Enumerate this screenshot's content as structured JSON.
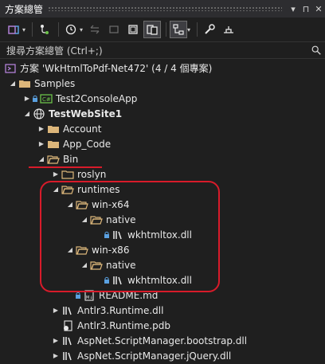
{
  "window": {
    "title": "方案總管",
    "buttons": [
      "▾",
      "⊓",
      "✕"
    ]
  },
  "toolbar": {
    "icons": [
      "switch-views-icon",
      "git-icon",
      "history-icon",
      "back-icon",
      "forward-icon",
      "collapse-all-icon",
      "show-all-files-icon",
      "preview-icon",
      "properties-icon",
      "pin-icon"
    ]
  },
  "search": {
    "placeholder": "搜尋方案總管 (Ctrl+;)"
  },
  "tree": {
    "solution": "方案 'WkHtmlToPdf-Net472' (4 / 4 個專案)",
    "samples": "Samples",
    "test2": "Test2ConsoleApp",
    "website": "TestWebSite1",
    "account": "Account",
    "appcode": "App_Code",
    "bin": "Bin",
    "roslyn": "roslyn",
    "runtimes": "runtimes",
    "winx64": "win-x64",
    "native1": "native",
    "dll1": "wkhtmltox.dll",
    "winx86": "win-x86",
    "native2": "native",
    "dll2": "wkhtmltox.dll",
    "readme": "README.md",
    "antlr_dll": "Antlr3.Runtime.dll",
    "antlr_pdb": "Antlr3.Runtime.pdb",
    "aspnet_bootstrap": "AspNet.ScriptManager.bootstrap.dll",
    "aspnet_jquery": "AspNet.ScriptManager.jQuery.dll"
  },
  "colors": {
    "folder": "#dcb67a",
    "annotation": "#d81b2a",
    "background": "#1f1f1f"
  }
}
